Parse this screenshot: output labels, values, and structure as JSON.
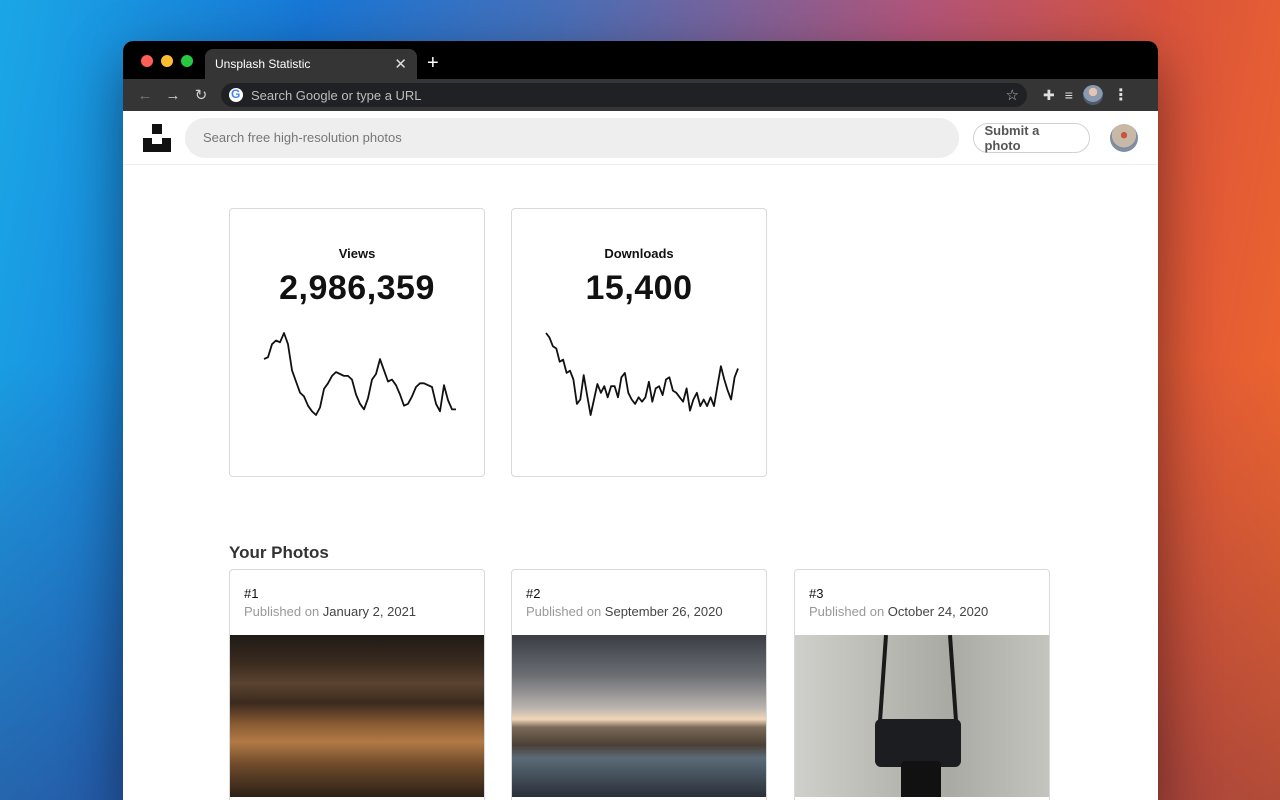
{
  "browser": {
    "tab_title": "Unsplash Statistic",
    "tab_close": "✕",
    "new_tab": "+",
    "back_icon": "←",
    "forward_icon": "→",
    "reload_icon": "↻",
    "omnibox_placeholder": "Search Google or type a URL",
    "star_icon": "☆",
    "extensions_icon": "✚",
    "media_icon": "≡",
    "menu_icon": "⋮"
  },
  "site": {
    "search_placeholder": "Search free high-resolution photos",
    "submit_label": "Submit a photo"
  },
  "stats": {
    "views": {
      "label": "Views",
      "value": "2,986,359"
    },
    "downloads": {
      "label": "Downloads",
      "value": "15,400"
    }
  },
  "chart_data": [
    {
      "type": "line",
      "series": [
        {
          "values": [
            30,
            31,
            38,
            40,
            39,
            44,
            38,
            24,
            18,
            12,
            10,
            5,
            2,
            0,
            4,
            14,
            17,
            21,
            23,
            22,
            21,
            21,
            19,
            11,
            6,
            3,
            9,
            19,
            22,
            30,
            24,
            18,
            19,
            16,
            11,
            5,
            6,
            10,
            15,
            17,
            17,
            16,
            15,
            6,
            2,
            16,
            8,
            3,
            3
          ]
        }
      ],
      "legend": "none",
      "grid": false
    },
    {
      "type": "line",
      "series": [
        {
          "values": [
            40,
            38,
            34,
            33,
            27,
            28,
            22,
            23,
            19,
            8,
            10,
            21,
            12,
            3,
            10,
            17,
            13,
            16,
            11,
            16,
            16,
            11,
            20,
            22,
            13,
            10,
            8,
            11,
            9,
            11,
            18,
            9,
            15,
            16,
            12,
            19,
            20,
            14,
            13,
            11,
            9,
            15,
            5,
            10,
            13,
            7,
            10,
            7,
            11,
            7,
            16,
            25,
            19,
            14,
            10,
            20,
            24
          ]
        }
      ],
      "legend": "none",
      "grid": false
    }
  ],
  "photos_section": {
    "title": "Your Photos",
    "published_prefix": "Published on",
    "items": [
      {
        "rank": "#1",
        "date": "January 2, 2021"
      },
      {
        "rank": "#2",
        "date": "September 26, 2020"
      },
      {
        "rank": "#3",
        "date": "October 24, 2020"
      }
    ]
  }
}
